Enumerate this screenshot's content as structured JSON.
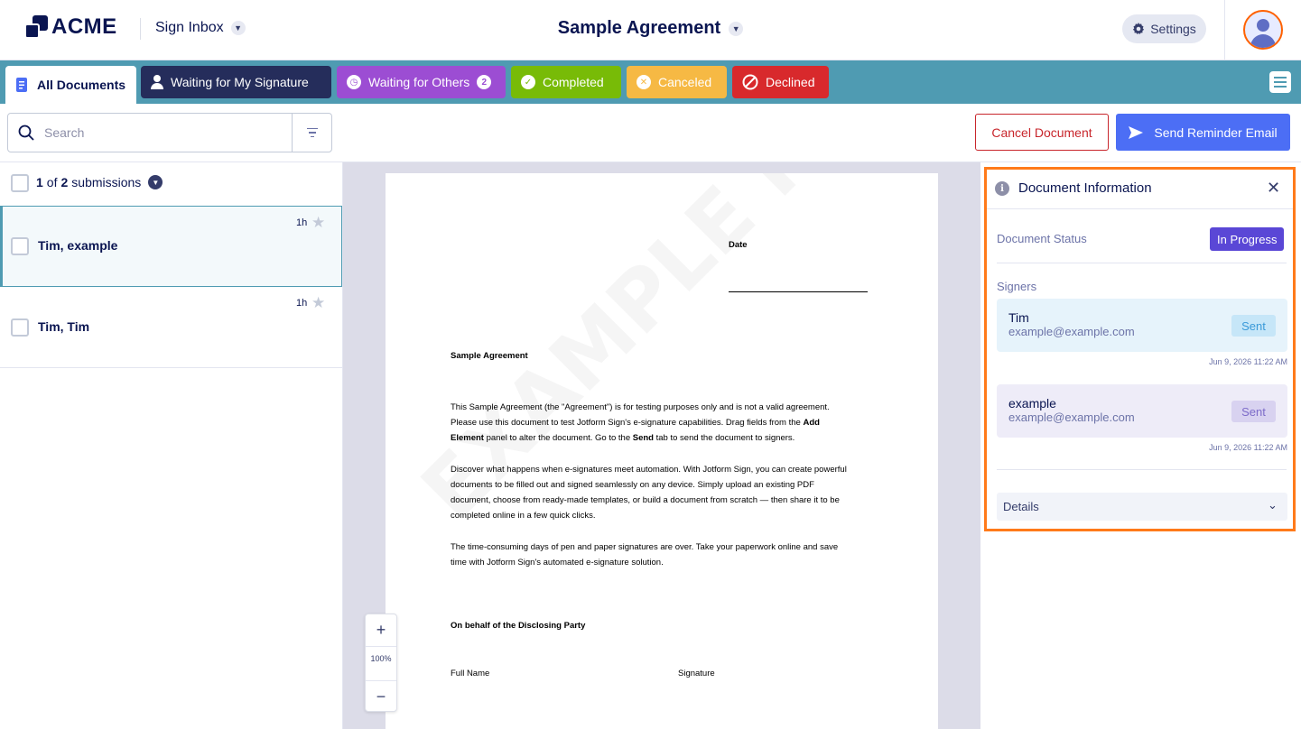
{
  "header": {
    "logo_text": "ACME",
    "inbox_label": "Sign Inbox",
    "doc_title": "Sample Agreement",
    "settings_label": "Settings"
  },
  "tabs": [
    {
      "label": "All Documents",
      "color": "#ffffff"
    },
    {
      "label": "Waiting for My Signature",
      "color": "#252d5b"
    },
    {
      "label": "Waiting for Others",
      "badge": "2",
      "color": "#9c4dd3"
    },
    {
      "label": "Completed",
      "color": "#78bb07"
    },
    {
      "label": "Canceled",
      "color": "#f6b944"
    },
    {
      "label": "Declined",
      "color": "#d8292c"
    }
  ],
  "search": {
    "placeholder": "Search"
  },
  "actions": {
    "cancel_label": "Cancel Document",
    "remind_label": "Send Reminder Email"
  },
  "list": {
    "count_current": "1",
    "count_of": "of",
    "count_total": "2",
    "count_suffix": "submissions",
    "items": [
      {
        "name": "Tim, example",
        "time": "1h",
        "selected": true
      },
      {
        "name": "Tim, Tim",
        "time": "1h",
        "selected": false
      }
    ]
  },
  "document": {
    "watermark": "EXAMPLE PDF",
    "date_label": "Date",
    "heading": "Sample Agreement",
    "p1a": "This Sample Agreement (the \"Agreement\") is for testing purposes only and is not a valid agreement.",
    "p1b": "Please use this document to test Jotform Sign's e-signature capabilities. Drag fields from the",
    "p1c": "Add",
    "p1d": "Element",
    "p1e": "panel to alter the document. Go to the",
    "p1f": "Send",
    "p1g": "tab to send the document to signers.",
    "p2a": "Discover what happens when e-signatures meet automation. With Jotform Sign, you can create powerful",
    "p2b": "documents to be filled out and signed seamlessly on any device. Simply upload an existing PDF",
    "p2c": "document, choose from ready-made templates, or build a document from scratch — then share it to be",
    "p2d": "completed online in a few quick clicks.",
    "p3a": "The time-consuming days of pen and paper signatures are over. Take your paperwork online and save",
    "p3b": "time with Jotform Sign's automated e-signature solution.",
    "party": "On behalf of the Disclosing Party",
    "full_name": "Full Name",
    "signature": "Signature"
  },
  "zoom": {
    "level": "100%"
  },
  "info": {
    "title": "Document Information",
    "status_label": "Document Status",
    "status_value": "In Progress",
    "signers_label": "Signers",
    "signers": [
      {
        "name": "Tim",
        "email": "example@example.com",
        "status": "Sent",
        "date": "Jun 9, 2026 11:22 AM"
      },
      {
        "name": "example",
        "email": "example@example.com",
        "status": "Sent",
        "date": "Jun 9, 2026 11:22 AM"
      }
    ],
    "details_label": "Details"
  },
  "colors": {
    "accent": "#4c6ef5",
    "tabbar": "#4f9bb2",
    "highlight": "#ff7a1a",
    "status": "#5a47d6"
  }
}
